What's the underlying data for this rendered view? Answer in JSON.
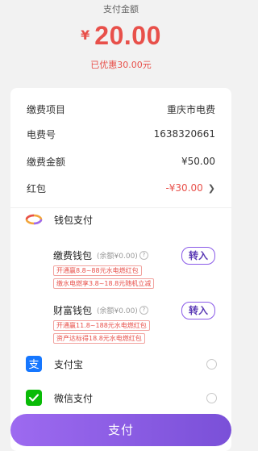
{
  "header": {
    "title": "支付金额",
    "currency": "¥",
    "amount": "20.00",
    "discount": "已优惠30.00元"
  },
  "details": [
    {
      "key": "缴费项目",
      "value": "重庆市电费"
    },
    {
      "key": "电费号",
      "value": "1638320661"
    },
    {
      "key": "缴费金额",
      "value": "¥50.00"
    },
    {
      "key": "红包",
      "value": "-¥30.00"
    }
  ],
  "wallet": {
    "title": "钱包支付",
    "items": [
      {
        "name": "缴费钱包",
        "balance": "(余额¥0.00)",
        "button": "转入",
        "tags": [
          "开通赢8.8~88元水电燃红包",
          "缴水电燃享3.8~18.8元随机立减"
        ]
      },
      {
        "name": "财富钱包",
        "balance": "(余额¥0.00)",
        "button": "转入",
        "tags": [
          "开通赢11.8~188元水电燃红包",
          "资产达标得18.8元水电燃红包"
        ]
      }
    ]
  },
  "methods": [
    {
      "label": "支付宝",
      "icon": "alipay-icon",
      "color": "#1677ff"
    },
    {
      "label": "微信支付",
      "icon": "wechat-pay-icon",
      "color": "#09bb07"
    }
  ],
  "pay_button": "支付",
  "colors": {
    "accent": "#8a5ae8",
    "price": "#e8504a"
  }
}
